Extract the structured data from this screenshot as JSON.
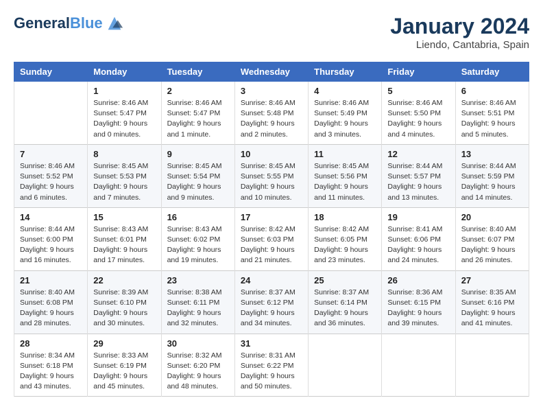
{
  "header": {
    "logo_line1": "General",
    "logo_line2": "Blue",
    "title": "January 2024",
    "subtitle": "Liendo, Cantabria, Spain"
  },
  "days_of_week": [
    "Sunday",
    "Monday",
    "Tuesday",
    "Wednesday",
    "Thursday",
    "Friday",
    "Saturday"
  ],
  "weeks": [
    [
      {
        "day": "",
        "sunrise": "",
        "sunset": "",
        "daylight": ""
      },
      {
        "day": "1",
        "sunrise": "Sunrise: 8:46 AM",
        "sunset": "Sunset: 5:47 PM",
        "daylight": "Daylight: 9 hours and 0 minutes."
      },
      {
        "day": "2",
        "sunrise": "Sunrise: 8:46 AM",
        "sunset": "Sunset: 5:47 PM",
        "daylight": "Daylight: 9 hours and 1 minute."
      },
      {
        "day": "3",
        "sunrise": "Sunrise: 8:46 AM",
        "sunset": "Sunset: 5:48 PM",
        "daylight": "Daylight: 9 hours and 2 minutes."
      },
      {
        "day": "4",
        "sunrise": "Sunrise: 8:46 AM",
        "sunset": "Sunset: 5:49 PM",
        "daylight": "Daylight: 9 hours and 3 minutes."
      },
      {
        "day": "5",
        "sunrise": "Sunrise: 8:46 AM",
        "sunset": "Sunset: 5:50 PM",
        "daylight": "Daylight: 9 hours and 4 minutes."
      },
      {
        "day": "6",
        "sunrise": "Sunrise: 8:46 AM",
        "sunset": "Sunset: 5:51 PM",
        "daylight": "Daylight: 9 hours and 5 minutes."
      }
    ],
    [
      {
        "day": "7",
        "sunrise": "Sunrise: 8:46 AM",
        "sunset": "Sunset: 5:52 PM",
        "daylight": "Daylight: 9 hours and 6 minutes."
      },
      {
        "day": "8",
        "sunrise": "Sunrise: 8:45 AM",
        "sunset": "Sunset: 5:53 PM",
        "daylight": "Daylight: 9 hours and 7 minutes."
      },
      {
        "day": "9",
        "sunrise": "Sunrise: 8:45 AM",
        "sunset": "Sunset: 5:54 PM",
        "daylight": "Daylight: 9 hours and 9 minutes."
      },
      {
        "day": "10",
        "sunrise": "Sunrise: 8:45 AM",
        "sunset": "Sunset: 5:55 PM",
        "daylight": "Daylight: 9 hours and 10 minutes."
      },
      {
        "day": "11",
        "sunrise": "Sunrise: 8:45 AM",
        "sunset": "Sunset: 5:56 PM",
        "daylight": "Daylight: 9 hours and 11 minutes."
      },
      {
        "day": "12",
        "sunrise": "Sunrise: 8:44 AM",
        "sunset": "Sunset: 5:57 PM",
        "daylight": "Daylight: 9 hours and 13 minutes."
      },
      {
        "day": "13",
        "sunrise": "Sunrise: 8:44 AM",
        "sunset": "Sunset: 5:59 PM",
        "daylight": "Daylight: 9 hours and 14 minutes."
      }
    ],
    [
      {
        "day": "14",
        "sunrise": "Sunrise: 8:44 AM",
        "sunset": "Sunset: 6:00 PM",
        "daylight": "Daylight: 9 hours and 16 minutes."
      },
      {
        "day": "15",
        "sunrise": "Sunrise: 8:43 AM",
        "sunset": "Sunset: 6:01 PM",
        "daylight": "Daylight: 9 hours and 17 minutes."
      },
      {
        "day": "16",
        "sunrise": "Sunrise: 8:43 AM",
        "sunset": "Sunset: 6:02 PM",
        "daylight": "Daylight: 9 hours and 19 minutes."
      },
      {
        "day": "17",
        "sunrise": "Sunrise: 8:42 AM",
        "sunset": "Sunset: 6:03 PM",
        "daylight": "Daylight: 9 hours and 21 minutes."
      },
      {
        "day": "18",
        "sunrise": "Sunrise: 8:42 AM",
        "sunset": "Sunset: 6:05 PM",
        "daylight": "Daylight: 9 hours and 23 minutes."
      },
      {
        "day": "19",
        "sunrise": "Sunrise: 8:41 AM",
        "sunset": "Sunset: 6:06 PM",
        "daylight": "Daylight: 9 hours and 24 minutes."
      },
      {
        "day": "20",
        "sunrise": "Sunrise: 8:40 AM",
        "sunset": "Sunset: 6:07 PM",
        "daylight": "Daylight: 9 hours and 26 minutes."
      }
    ],
    [
      {
        "day": "21",
        "sunrise": "Sunrise: 8:40 AM",
        "sunset": "Sunset: 6:08 PM",
        "daylight": "Daylight: 9 hours and 28 minutes."
      },
      {
        "day": "22",
        "sunrise": "Sunrise: 8:39 AM",
        "sunset": "Sunset: 6:10 PM",
        "daylight": "Daylight: 9 hours and 30 minutes."
      },
      {
        "day": "23",
        "sunrise": "Sunrise: 8:38 AM",
        "sunset": "Sunset: 6:11 PM",
        "daylight": "Daylight: 9 hours and 32 minutes."
      },
      {
        "day": "24",
        "sunrise": "Sunrise: 8:37 AM",
        "sunset": "Sunset: 6:12 PM",
        "daylight": "Daylight: 9 hours and 34 minutes."
      },
      {
        "day": "25",
        "sunrise": "Sunrise: 8:37 AM",
        "sunset": "Sunset: 6:14 PM",
        "daylight": "Daylight: 9 hours and 36 minutes."
      },
      {
        "day": "26",
        "sunrise": "Sunrise: 8:36 AM",
        "sunset": "Sunset: 6:15 PM",
        "daylight": "Daylight: 9 hours and 39 minutes."
      },
      {
        "day": "27",
        "sunrise": "Sunrise: 8:35 AM",
        "sunset": "Sunset: 6:16 PM",
        "daylight": "Daylight: 9 hours and 41 minutes."
      }
    ],
    [
      {
        "day": "28",
        "sunrise": "Sunrise: 8:34 AM",
        "sunset": "Sunset: 6:18 PM",
        "daylight": "Daylight: 9 hours and 43 minutes."
      },
      {
        "day": "29",
        "sunrise": "Sunrise: 8:33 AM",
        "sunset": "Sunset: 6:19 PM",
        "daylight": "Daylight: 9 hours and 45 minutes."
      },
      {
        "day": "30",
        "sunrise": "Sunrise: 8:32 AM",
        "sunset": "Sunset: 6:20 PM",
        "daylight": "Daylight: 9 hours and 48 minutes."
      },
      {
        "day": "31",
        "sunrise": "Sunrise: 8:31 AM",
        "sunset": "Sunset: 6:22 PM",
        "daylight": "Daylight: 9 hours and 50 minutes."
      },
      {
        "day": "",
        "sunrise": "",
        "sunset": "",
        "daylight": ""
      },
      {
        "day": "",
        "sunrise": "",
        "sunset": "",
        "daylight": ""
      },
      {
        "day": "",
        "sunrise": "",
        "sunset": "",
        "daylight": ""
      }
    ]
  ]
}
